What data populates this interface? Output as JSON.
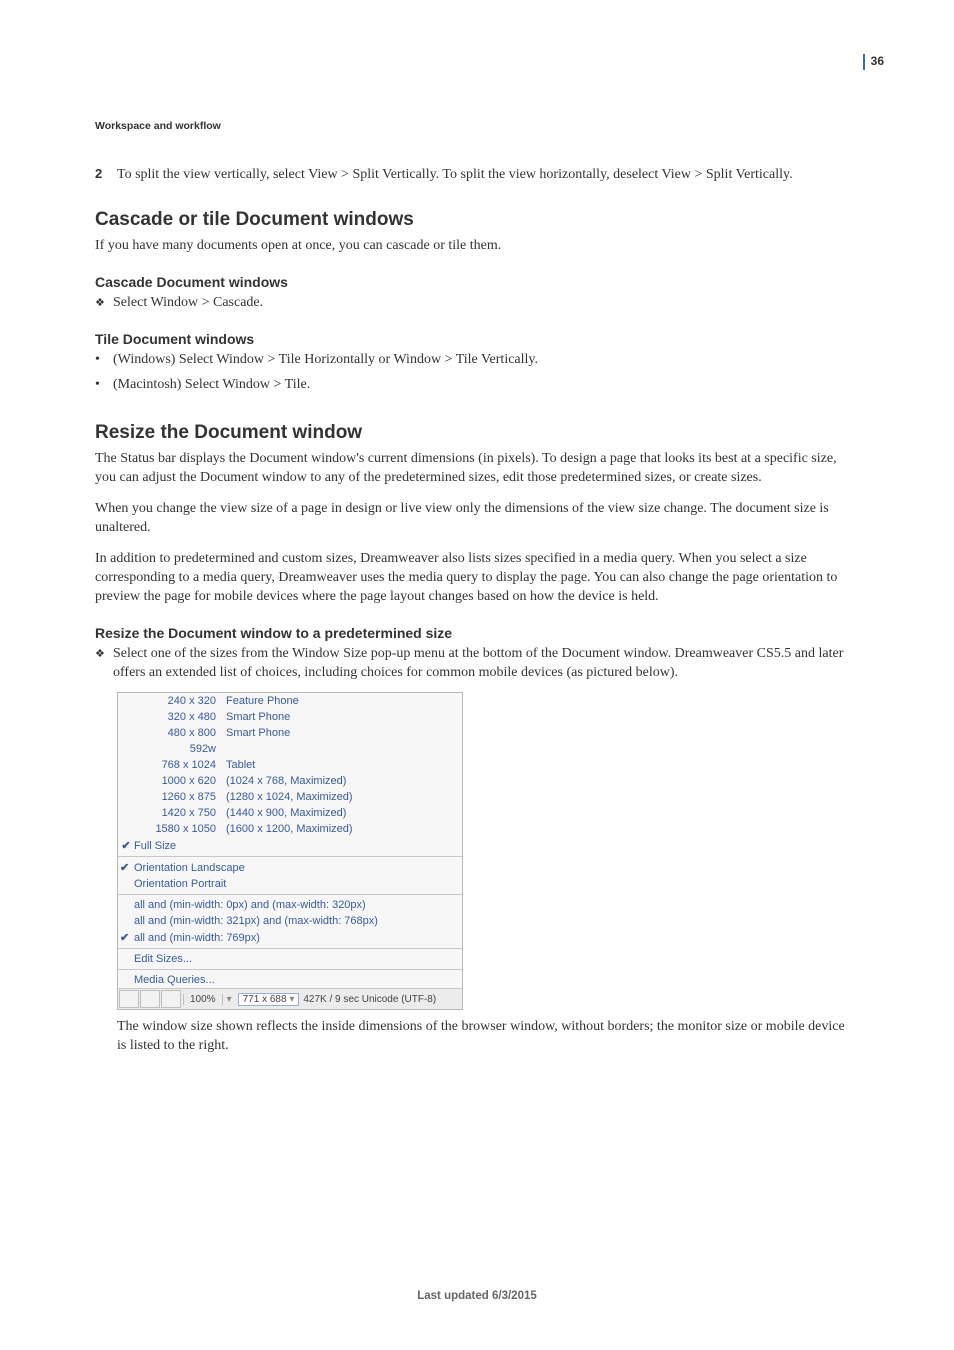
{
  "page_number": "36",
  "header": {
    "section_label": "Workspace and workflow"
  },
  "intro_step": {
    "num": "2",
    "text": "To split the view vertically, select View > Split Vertically. To split the view horizontally, deselect View > Split Vertically."
  },
  "sec_cascade": {
    "title": "Cascade or tile Document windows",
    "intro": "If you have many documents open at once, you can cascade or tile them.",
    "sub1_title": "Cascade Document windows",
    "sub1_item": "Select Window > Cascade.",
    "sub2_title": "Tile Document windows",
    "sub2_item1": "(Windows) Select Window > Tile Horizontally or Window > Tile Vertically.",
    "sub2_item2": "(Macintosh) Select Window > Tile."
  },
  "sec_resize": {
    "title": "Resize the Document window",
    "p1": "The Status bar displays the Document window's current dimensions (in pixels). To design a page that looks its best at a specific size, you can adjust the Document window to any of the predetermined sizes, edit those predetermined sizes, or create sizes.",
    "p2": "When you change the view size of a page in design or live view only the dimensions of the view size change. The document size is unaltered.",
    "p3": "In addition to predetermined and custom sizes, Dreamweaver also lists sizes specified in a media query. When you select a size corresponding to a media query, Dreamweaver uses the media query to display the page. You can also change the page orientation to preview the page for mobile devices where the page layout changes based on how the device is held.",
    "sub_title": "Resize the Document window to a predetermined size",
    "sub_item": "Select one of the sizes from the Window Size pop-up menu at the bottom of the Document window. Dreamweaver CS5.5 and later offers an extended list of choices, including choices for common mobile devices (as pictured below)."
  },
  "menu": {
    "rows": [
      {
        "dims": "240 x  320",
        "desc": "Feature Phone"
      },
      {
        "dims": "320 x  480",
        "desc": "Smart Phone"
      },
      {
        "dims": "480 x  800",
        "desc": "Smart Phone"
      },
      {
        "dims": "592w",
        "desc": ""
      },
      {
        "dims": "768 x 1024",
        "desc": "Tablet"
      },
      {
        "dims": "1000 x  620",
        "desc": "(1024 x 768, Maximized)"
      },
      {
        "dims": "1260 x  875",
        "desc": "(1280 x 1024, Maximized)"
      },
      {
        "dims": "1420 x  750",
        "desc": "(1440 x 900, Maximized)"
      },
      {
        "dims": "1580 x 1050",
        "desc": "(1600 x 1200, Maximized)"
      }
    ],
    "full_size": "Full Size",
    "orient_landscape": "Orientation Landscape",
    "orient_portrait": "Orientation Portrait",
    "mq1": "all and (min-width: 0px) and (max-width: 320px)",
    "mq2": "all and (min-width: 321px) and (max-width: 768px)",
    "mq3": "all and (min-width: 769px)",
    "edit_sizes": "Edit Sizes...",
    "media_queries": "Media Queries..."
  },
  "statusbar": {
    "zoom": "100%",
    "size_field": "771 x 688",
    "rest": "427K / 9 sec  Unicode (UTF-8)"
  },
  "caption": "The window size shown reflects the inside dimensions of the browser window, without borders; the monitor size or mobile device is listed to the right.",
  "footer": "Last updated 6/3/2015"
}
